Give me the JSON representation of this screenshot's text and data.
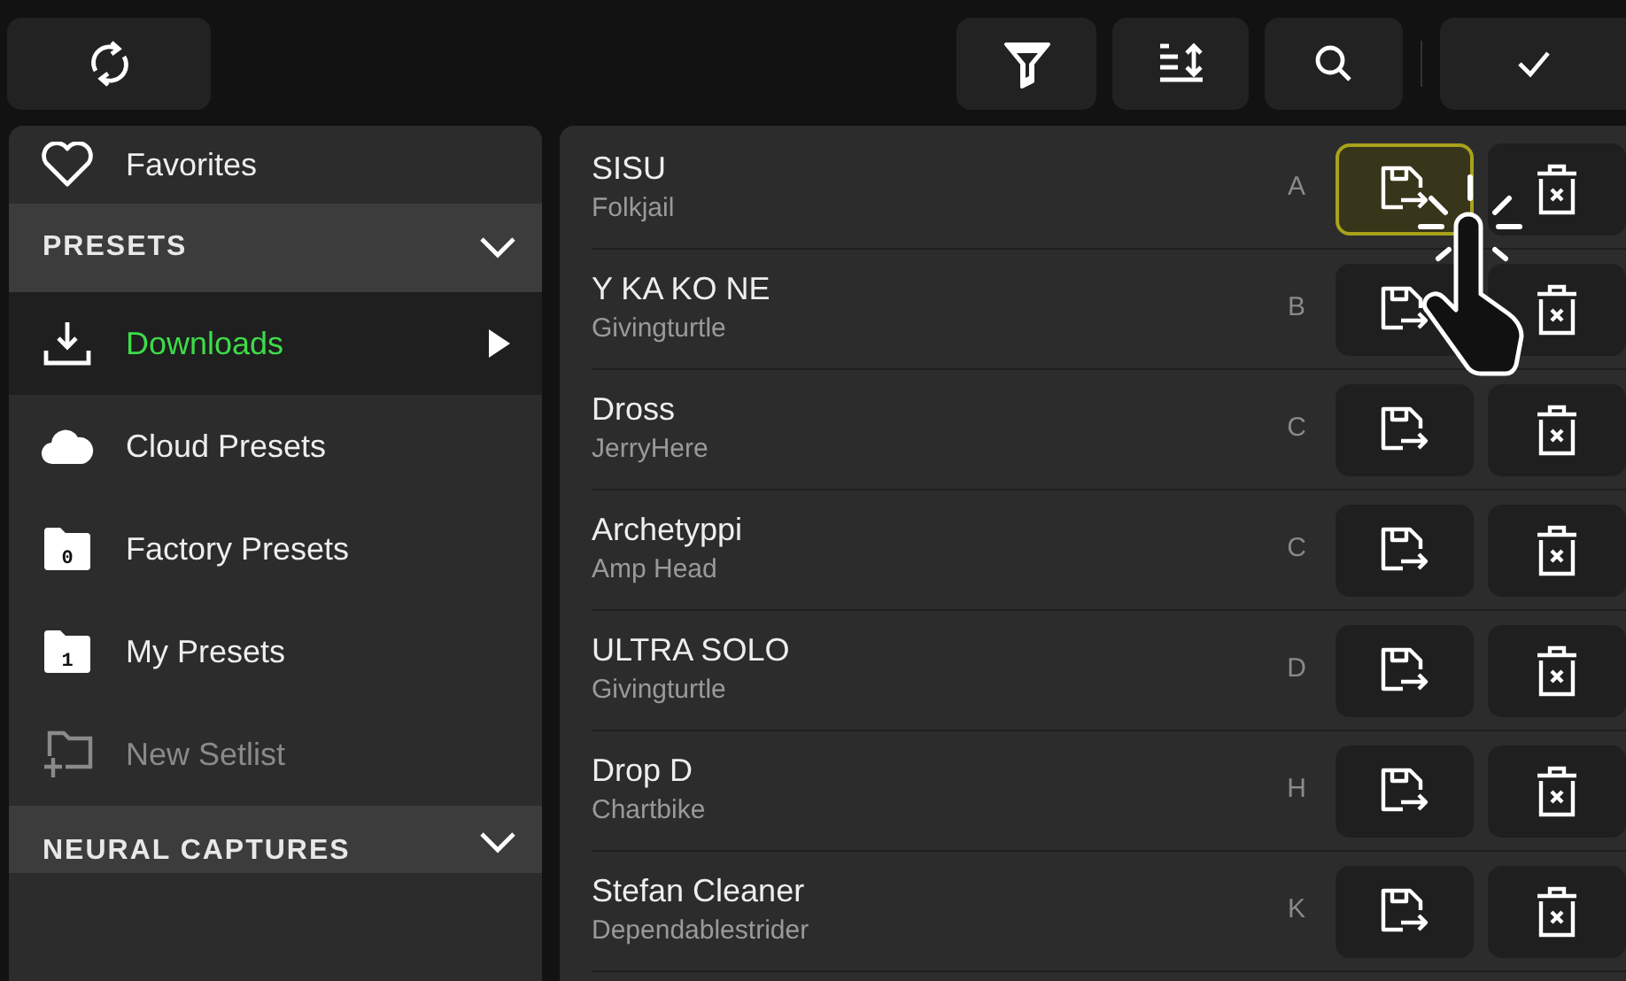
{
  "sidebar": {
    "favorites": {
      "label": "Favorites"
    },
    "sections": [
      {
        "title": "PRESETS",
        "expanded": true,
        "items": [
          {
            "kind": "download",
            "label": "Downloads",
            "selected": true,
            "disabled": false
          },
          {
            "kind": "cloud",
            "label": "Cloud Presets",
            "selected": false,
            "disabled": false
          },
          {
            "kind": "folder",
            "label": "Factory Presets",
            "badge": "0",
            "selected": false,
            "disabled": false
          },
          {
            "kind": "folder",
            "label": "My Presets",
            "badge": "1",
            "selected": false,
            "disabled": false
          },
          {
            "kind": "new-folder",
            "label": "New Setlist",
            "selected": false,
            "disabled": true
          }
        ]
      },
      {
        "title": "NEURAL CAPTURES",
        "expanded": true
      }
    ]
  },
  "presets": [
    {
      "name": "SISU",
      "author": "Folkjail",
      "slot": "A",
      "load_highlighted": true
    },
    {
      "name": "Y KA KO NE",
      "author": "Givingturtle",
      "slot": "B",
      "load_highlighted": false
    },
    {
      "name": "Dross",
      "author": "JerryHere",
      "slot": "C",
      "load_highlighted": false
    },
    {
      "name": "Archetyppi",
      "author": "Amp Head",
      "slot": "C",
      "load_highlighted": false
    },
    {
      "name": "ULTRA SOLO",
      "author": "Givingturtle",
      "slot": "D",
      "load_highlighted": false
    },
    {
      "name": "Drop D",
      "author": "Chartbike",
      "slot": "H",
      "load_highlighted": false
    },
    {
      "name": "Stefan Cleaner",
      "author": "Dependablestrider",
      "slot": "K",
      "load_highlighted": false
    }
  ]
}
